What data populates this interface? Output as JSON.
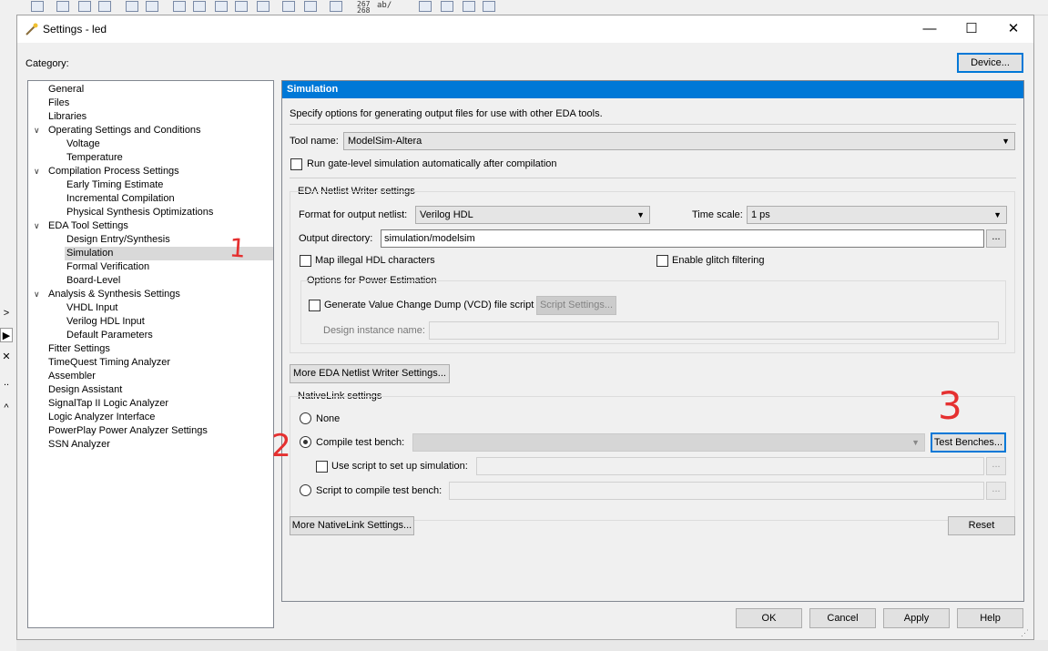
{
  "dialog": {
    "title": "Settings - led",
    "category_label": "Category:",
    "device_button": "Device...",
    "minimize": "—",
    "maximize": "☐",
    "close": "✕"
  },
  "toolbar": {
    "counter_top": "267",
    "counter_bottom": "268",
    "ab_label": "ab/"
  },
  "side_buttons": [
    ">",
    "▶",
    "✕",
    "..",
    "^"
  ],
  "tree": [
    {
      "label": "General",
      "level": 0
    },
    {
      "label": "Files",
      "level": 0
    },
    {
      "label": "Libraries",
      "level": 0
    },
    {
      "label": "Operating Settings and Conditions",
      "level": 0,
      "expanded": true
    },
    {
      "label": "Voltage",
      "level": 1
    },
    {
      "label": "Temperature",
      "level": 1
    },
    {
      "label": "Compilation Process Settings",
      "level": 0,
      "expanded": true
    },
    {
      "label": "Early Timing Estimate",
      "level": 1
    },
    {
      "label": "Incremental Compilation",
      "level": 1
    },
    {
      "label": "Physical Synthesis Optimizations",
      "level": 1
    },
    {
      "label": "EDA Tool Settings",
      "level": 0,
      "expanded": true
    },
    {
      "label": "Design Entry/Synthesis",
      "level": 1
    },
    {
      "label": "Simulation",
      "level": 1,
      "selected": true
    },
    {
      "label": "Formal Verification",
      "level": 1
    },
    {
      "label": "Board-Level",
      "level": 1
    },
    {
      "label": "Analysis & Synthesis Settings",
      "level": 0,
      "expanded": true
    },
    {
      "label": "VHDL Input",
      "level": 1
    },
    {
      "label": "Verilog HDL Input",
      "level": 1
    },
    {
      "label": "Default Parameters",
      "level": 1
    },
    {
      "label": "Fitter Settings",
      "level": 0
    },
    {
      "label": "TimeQuest Timing Analyzer",
      "level": 0
    },
    {
      "label": "Assembler",
      "level": 0
    },
    {
      "label": "Design Assistant",
      "level": 0
    },
    {
      "label": "SignalTap II Logic Analyzer",
      "level": 0
    },
    {
      "label": "Logic Analyzer Interface",
      "level": 0
    },
    {
      "label": "PowerPlay Power Analyzer Settings",
      "level": 0
    },
    {
      "label": "SSN Analyzer",
      "level": 0
    }
  ],
  "panel": {
    "title": "Simulation",
    "description": "Specify options for generating output files for use with other EDA tools.",
    "tool_name_label": "Tool name:",
    "tool_name_value": "ModelSim-Altera",
    "run_gate_level_label": "Run gate-level simulation automatically after compilation",
    "run_gate_level_checked": false,
    "eda_group_title": "EDA Netlist Writer settings",
    "format_label": "Format for output netlist:",
    "format_value": "Verilog HDL",
    "time_scale_label": "Time scale:",
    "time_scale_value": "1 ps",
    "output_dir_label": "Output directory:",
    "output_dir_value": "simulation/modelsim",
    "browse": "...",
    "map_illegal_label": "Map illegal HDL characters",
    "map_illegal_checked": false,
    "glitch_label": "Enable glitch filtering",
    "glitch_checked": false,
    "power_group_title": "Options for Power Estimation",
    "vcd_label": "Generate Value Change Dump (VCD) file script",
    "vcd_checked": false,
    "script_settings": "Script Settings...",
    "design_instance_label": "Design instance name:",
    "design_instance_value": "",
    "more_eda_button": "More EDA Netlist Writer Settings...",
    "nativelink_group_title": "NativeLink settings",
    "none_label": "None",
    "compile_tb_label": "Compile test bench:",
    "compile_tb_value": "",
    "test_benches_button": "Test Benches...",
    "use_script_label": "Use script to set up simulation:",
    "use_script_value": "",
    "script_compile_label": "Script to compile test bench:",
    "script_compile_value": "",
    "selected_nativelink": "compile_tb",
    "more_nativelink_button": "More NativeLink Settings...",
    "reset_button": "Reset"
  },
  "footer": {
    "ok": "OK",
    "cancel": "Cancel",
    "apply": "Apply",
    "help": "Help"
  },
  "annotations": [
    "1",
    "2",
    "3"
  ],
  "colors": {
    "accent": "#0078d7",
    "annotation": "#e53030",
    "selection": "#d9d9d9"
  }
}
